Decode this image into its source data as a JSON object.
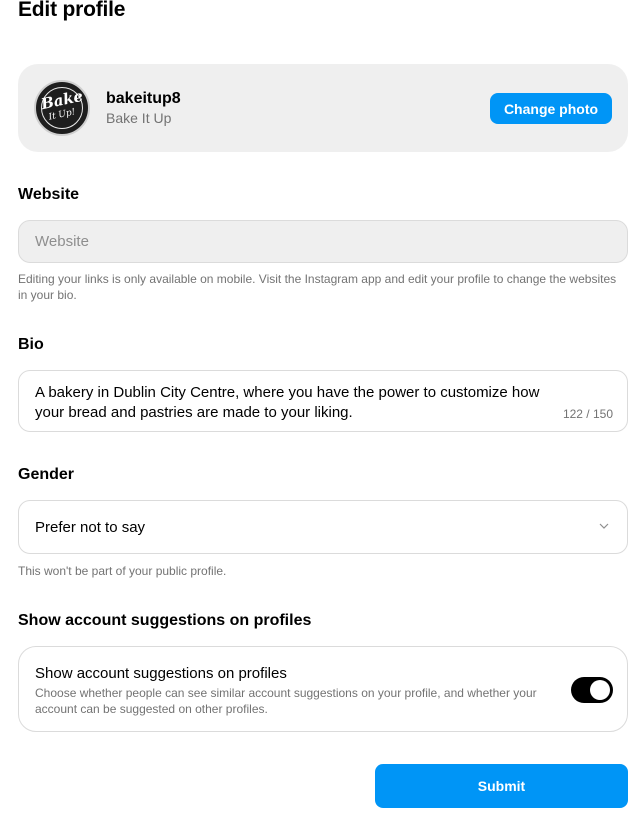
{
  "page": {
    "title": "Edit profile"
  },
  "profile": {
    "avatar_text_line1": "Bake",
    "avatar_text_line2": "It Up!",
    "username": "bakeitup8",
    "full_name": "Bake It Up",
    "change_photo_label": "Change photo"
  },
  "website": {
    "label": "Website",
    "placeholder": "Website",
    "value": "",
    "help": "Editing your links is only available on mobile. Visit the Instagram app and edit your profile to change the websites in your bio."
  },
  "bio": {
    "label": "Bio",
    "value": "A bakery in Dublin City Centre, where you have the power to customize how your bread and pastries are made to your liking.",
    "counter": "122 / 150"
  },
  "gender": {
    "label": "Gender",
    "selected": "Prefer not to say",
    "help": "This won't be part of your public profile."
  },
  "suggestions": {
    "section_label": "Show account suggestions on profiles",
    "title": "Show account suggestions on profiles",
    "description": "Choose whether people can see similar account suggestions on your profile, and whether your account can be suggested on other profiles.",
    "enabled": true
  },
  "submit_label": "Submit",
  "colors": {
    "accent": "#0095f6",
    "muted_text": "#737373",
    "card_bg": "#efefef",
    "border": "#dbdbdb"
  }
}
